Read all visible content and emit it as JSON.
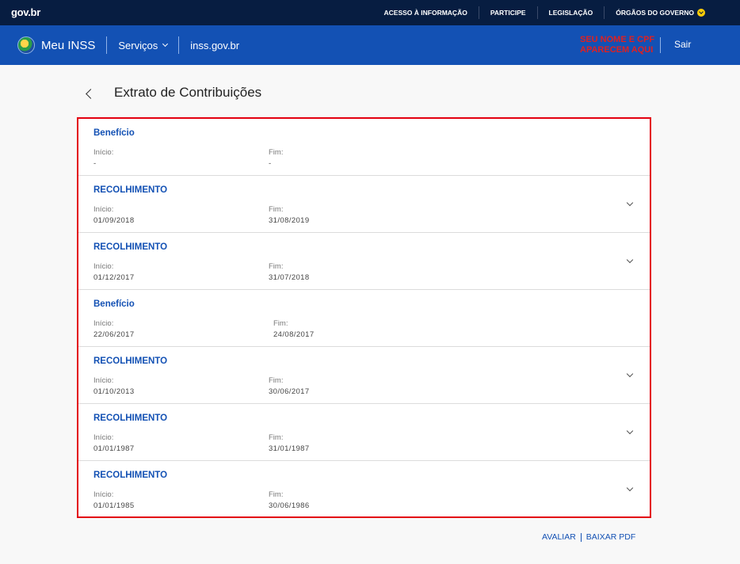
{
  "govbar": {
    "logo": "gov.br",
    "links": [
      {
        "label": "ACESSO À INFORMAÇÃO"
      },
      {
        "label": "PARTICIPE"
      },
      {
        "label": "LEGISLAÇÃO"
      },
      {
        "label": "ÓRGÃOS DO GOVERNO"
      }
    ]
  },
  "header": {
    "brand": "Meu INSS",
    "menu": "Serviços",
    "site": "inss.gov.br",
    "user_line1": "SEU NOME E CPF",
    "user_line2": "APARECEM AQUI",
    "logout": "Sair",
    "user_color": "#e02020"
  },
  "page": {
    "title": "Extrato de Contribuições"
  },
  "labels": {
    "inicio": "Início:",
    "fim": "Fim:"
  },
  "rows": [
    {
      "type": "Benefício",
      "inicio": "-",
      "fim": "-",
      "expandable": false
    },
    {
      "type": "RECOLHIMENTO",
      "inicio": "01/09/2018",
      "fim": "31/08/2019",
      "expandable": true
    },
    {
      "type": "RECOLHIMENTO",
      "inicio": "01/12/2017",
      "fim": "31/07/2018",
      "expandable": true
    },
    {
      "type": "Benefício",
      "inicio": "22/06/2017",
      "fim": "24/08/2017",
      "expandable": false
    },
    {
      "type": "RECOLHIMENTO",
      "inicio": "01/10/2013",
      "fim": "30/06/2017",
      "expandable": true
    },
    {
      "type": "RECOLHIMENTO",
      "inicio": "01/01/1987",
      "fim": "31/01/1987",
      "expandable": true
    },
    {
      "type": "RECOLHIMENTO",
      "inicio": "01/01/1985",
      "fim": "30/06/1986",
      "expandable": true
    }
  ],
  "footer": {
    "avaliar": "AVALIAR",
    "baixar": "BAIXAR PDF"
  },
  "colors": {
    "govbar": "#071d41",
    "header": "#1351b4",
    "highlight_border": "#e3000f",
    "link": "#1351b4"
  }
}
